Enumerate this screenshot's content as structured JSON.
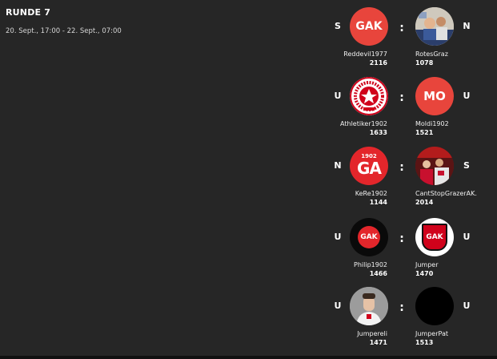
{
  "round": {
    "title": "RUNDE 7",
    "dates": "20. Sept., 17:00 - 22. Sept., 07:00"
  },
  "colors": {
    "background": "#262626",
    "gak_red": "#e8453c",
    "gak_red_dark": "#d0021b"
  },
  "matches": [
    {
      "left": {
        "result": "S",
        "name": "Reddevil1977",
        "score": "2116",
        "avatar": "gak-red-logo",
        "avatar_text": "GAK"
      },
      "separator": ":",
      "right": {
        "result": "N",
        "name": "RotesGraz",
        "score": "1078",
        "avatar": "photo-group"
      }
    },
    {
      "left": {
        "result": "U",
        "name": "Athletiker1902",
        "score": "1633",
        "avatar": "gak-crest-logo"
      },
      "separator": ":",
      "right": {
        "result": "U",
        "name": "Moldi1902",
        "score": "1521",
        "avatar": "initials-mo",
        "avatar_text": "MO"
      }
    },
    {
      "left": {
        "result": "N",
        "name": "KeRe1902",
        "score": "1144",
        "avatar": "gak-1902-logo",
        "avatar_text": "1902",
        "avatar_text2": "GA"
      },
      "separator": ":",
      "right": {
        "result": "S",
        "name": "CantStopGrazerAK.",
        "score": "2014",
        "avatar": "photo-fans"
      }
    },
    {
      "left": {
        "result": "U",
        "name": "Philip1902",
        "score": "1466",
        "avatar": "gak-black-logo",
        "avatar_text": "GAK"
      },
      "separator": ":",
      "right": {
        "result": "U",
        "name": "Jumper",
        "score": "1470",
        "avatar": "gak-shield-logo",
        "avatar_text": "GAK"
      }
    },
    {
      "left": {
        "result": "U",
        "name": "Jumpereli",
        "score": "1471",
        "avatar": "photo-person"
      },
      "separator": ":",
      "right": {
        "result": "U",
        "name": "JumperPat",
        "score": "1513",
        "avatar": "empty-black"
      }
    }
  ]
}
